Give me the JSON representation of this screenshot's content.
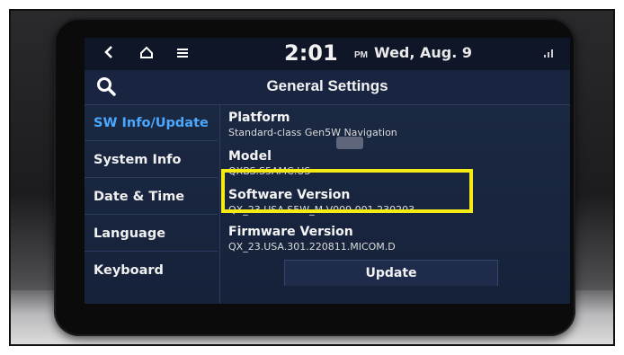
{
  "status_bar": {
    "back_icon": "back-arrow-icon",
    "home_icon": "home-icon",
    "menu_icon": "menu-icon",
    "time": "2:01",
    "ampm": "PM",
    "date": "Wed, Aug. 9",
    "signal_icon": "signal-icon"
  },
  "header": {
    "search_icon": "search-icon",
    "title": "General Settings"
  },
  "sidebar": {
    "items": [
      {
        "label": "SW Info/Update",
        "active": true
      },
      {
        "label": "System Info",
        "active": false
      },
      {
        "label": "Date & Time",
        "active": false
      },
      {
        "label": "Language",
        "active": false
      },
      {
        "label": "Keyboard",
        "active": false
      }
    ]
  },
  "info": {
    "rows": [
      {
        "title": "Platform",
        "value": "Standard-class Gen5W Navigation"
      },
      {
        "title": "Model",
        "value": "QXBS.S5AMC.US"
      },
      {
        "title": "Software Version",
        "value": "QX_23.USA.S5W_M.V009.001.230203"
      },
      {
        "title": "Firmware Version",
        "value": "QX_23.USA.301.220811.MICOM.D"
      }
    ],
    "update_label": "Update"
  },
  "colors": {
    "highlight": "#f5ea14",
    "active_item": "#4aa8ff",
    "screen_bg": "#1d2a45"
  }
}
